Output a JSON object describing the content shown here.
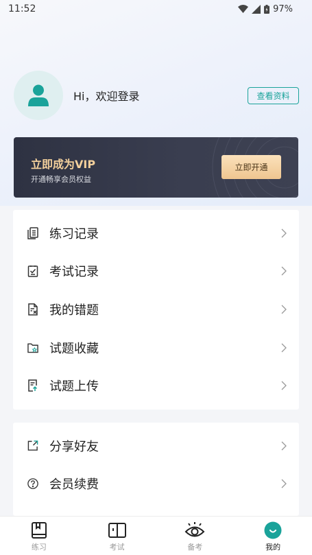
{
  "status": {
    "time": "11:52",
    "battery": "97%"
  },
  "profile": {
    "greeting": "Hi，欢迎登录",
    "view_button": "查看资料"
  },
  "vip": {
    "title": "立即成为VIP",
    "subtitle": "开通畅享会员权益",
    "button": "立即开通"
  },
  "menu_primary": [
    {
      "label": "练习记录",
      "icon": "notes-icon"
    },
    {
      "label": "考试记录",
      "icon": "checklist-icon"
    },
    {
      "label": "我的错题",
      "icon": "wrong-answer-icon"
    },
    {
      "label": "试题收藏",
      "icon": "folder-star-icon"
    },
    {
      "label": "试题上传",
      "icon": "upload-document-icon"
    }
  ],
  "menu_secondary": [
    {
      "label": "分享好友",
      "icon": "share-icon"
    },
    {
      "label": "会员续费",
      "icon": "help-circle-icon"
    }
  ],
  "tabs": [
    {
      "label": "练习",
      "icon": "book-icon"
    },
    {
      "label": "考试",
      "icon": "open-book-icon"
    },
    {
      "label": "备考",
      "icon": "eye-icon"
    },
    {
      "label": "我的",
      "icon": "smile-icon",
      "active": true
    }
  ],
  "colors": {
    "accent": "#1aa39a",
    "vip_gold": "#f3d09c",
    "vip_bg": "#2e3242"
  }
}
